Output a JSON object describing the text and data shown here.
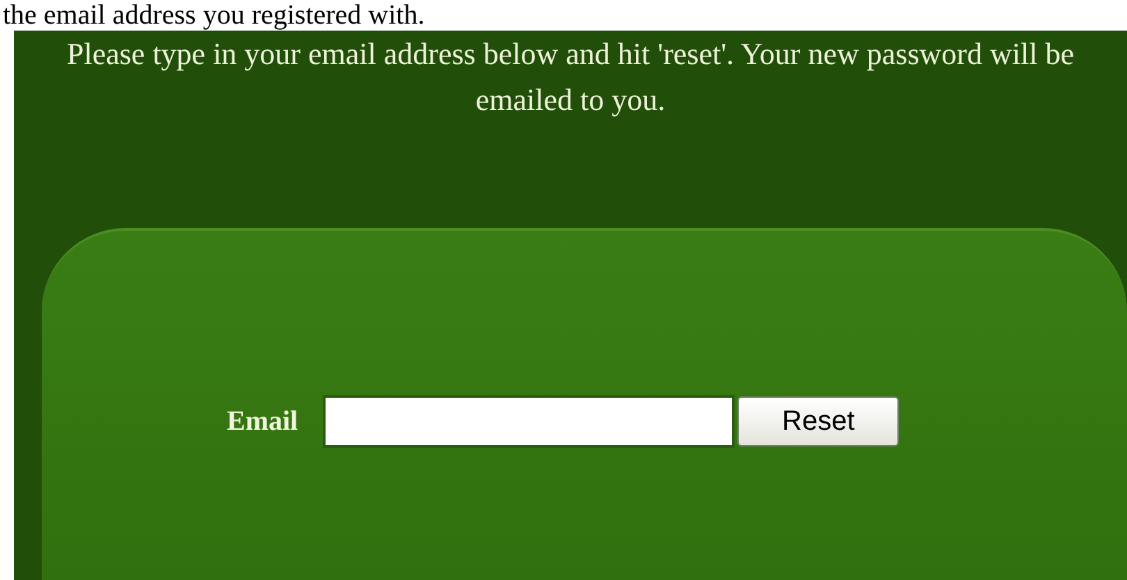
{
  "top_text": "the email address you registered with.",
  "instructions": "Please type in your email address below and hit 'reset'. Your new password will be emailed to you.",
  "form": {
    "label": "Email",
    "button": "Reset"
  }
}
